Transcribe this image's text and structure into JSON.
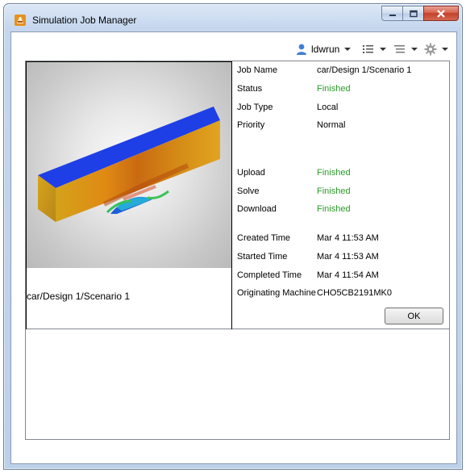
{
  "window": {
    "title": "Simulation Job Manager"
  },
  "toolbar": {
    "user_label": "ldwrun",
    "icons": [
      "user-icon",
      "list-view-icon",
      "tree-view-icon",
      "gear-icon"
    ]
  },
  "preview": {
    "caption": "car/Design 1/Scenario 1"
  },
  "details": {
    "job_name": {
      "label": "Job Name",
      "value": "car/Design 1/Scenario 1"
    },
    "status": {
      "label": "Status",
      "value": "Finished"
    },
    "job_type": {
      "label": "Job Type",
      "value": "Local"
    },
    "priority": {
      "label": "Priority",
      "value": "Normal"
    },
    "upload": {
      "label": "Upload",
      "value": "Finished"
    },
    "solve": {
      "label": "Solve",
      "value": "Finished"
    },
    "download": {
      "label": "Download",
      "value": "Finished"
    },
    "created": {
      "label": "Created Time",
      "value": "Mar 4 11:53 AM"
    },
    "started": {
      "label": "Started Time",
      "value": "Mar 4 11:53 AM"
    },
    "completed": {
      "label": "Completed Time",
      "value": "Mar 4 11:54 AM"
    },
    "machine": {
      "label": "Originating Machine",
      "value": "CHO5CB2191MK0"
    }
  },
  "buttons": {
    "ok": "OK"
  },
  "colors": {
    "status_finished": "#2a9b2a"
  }
}
